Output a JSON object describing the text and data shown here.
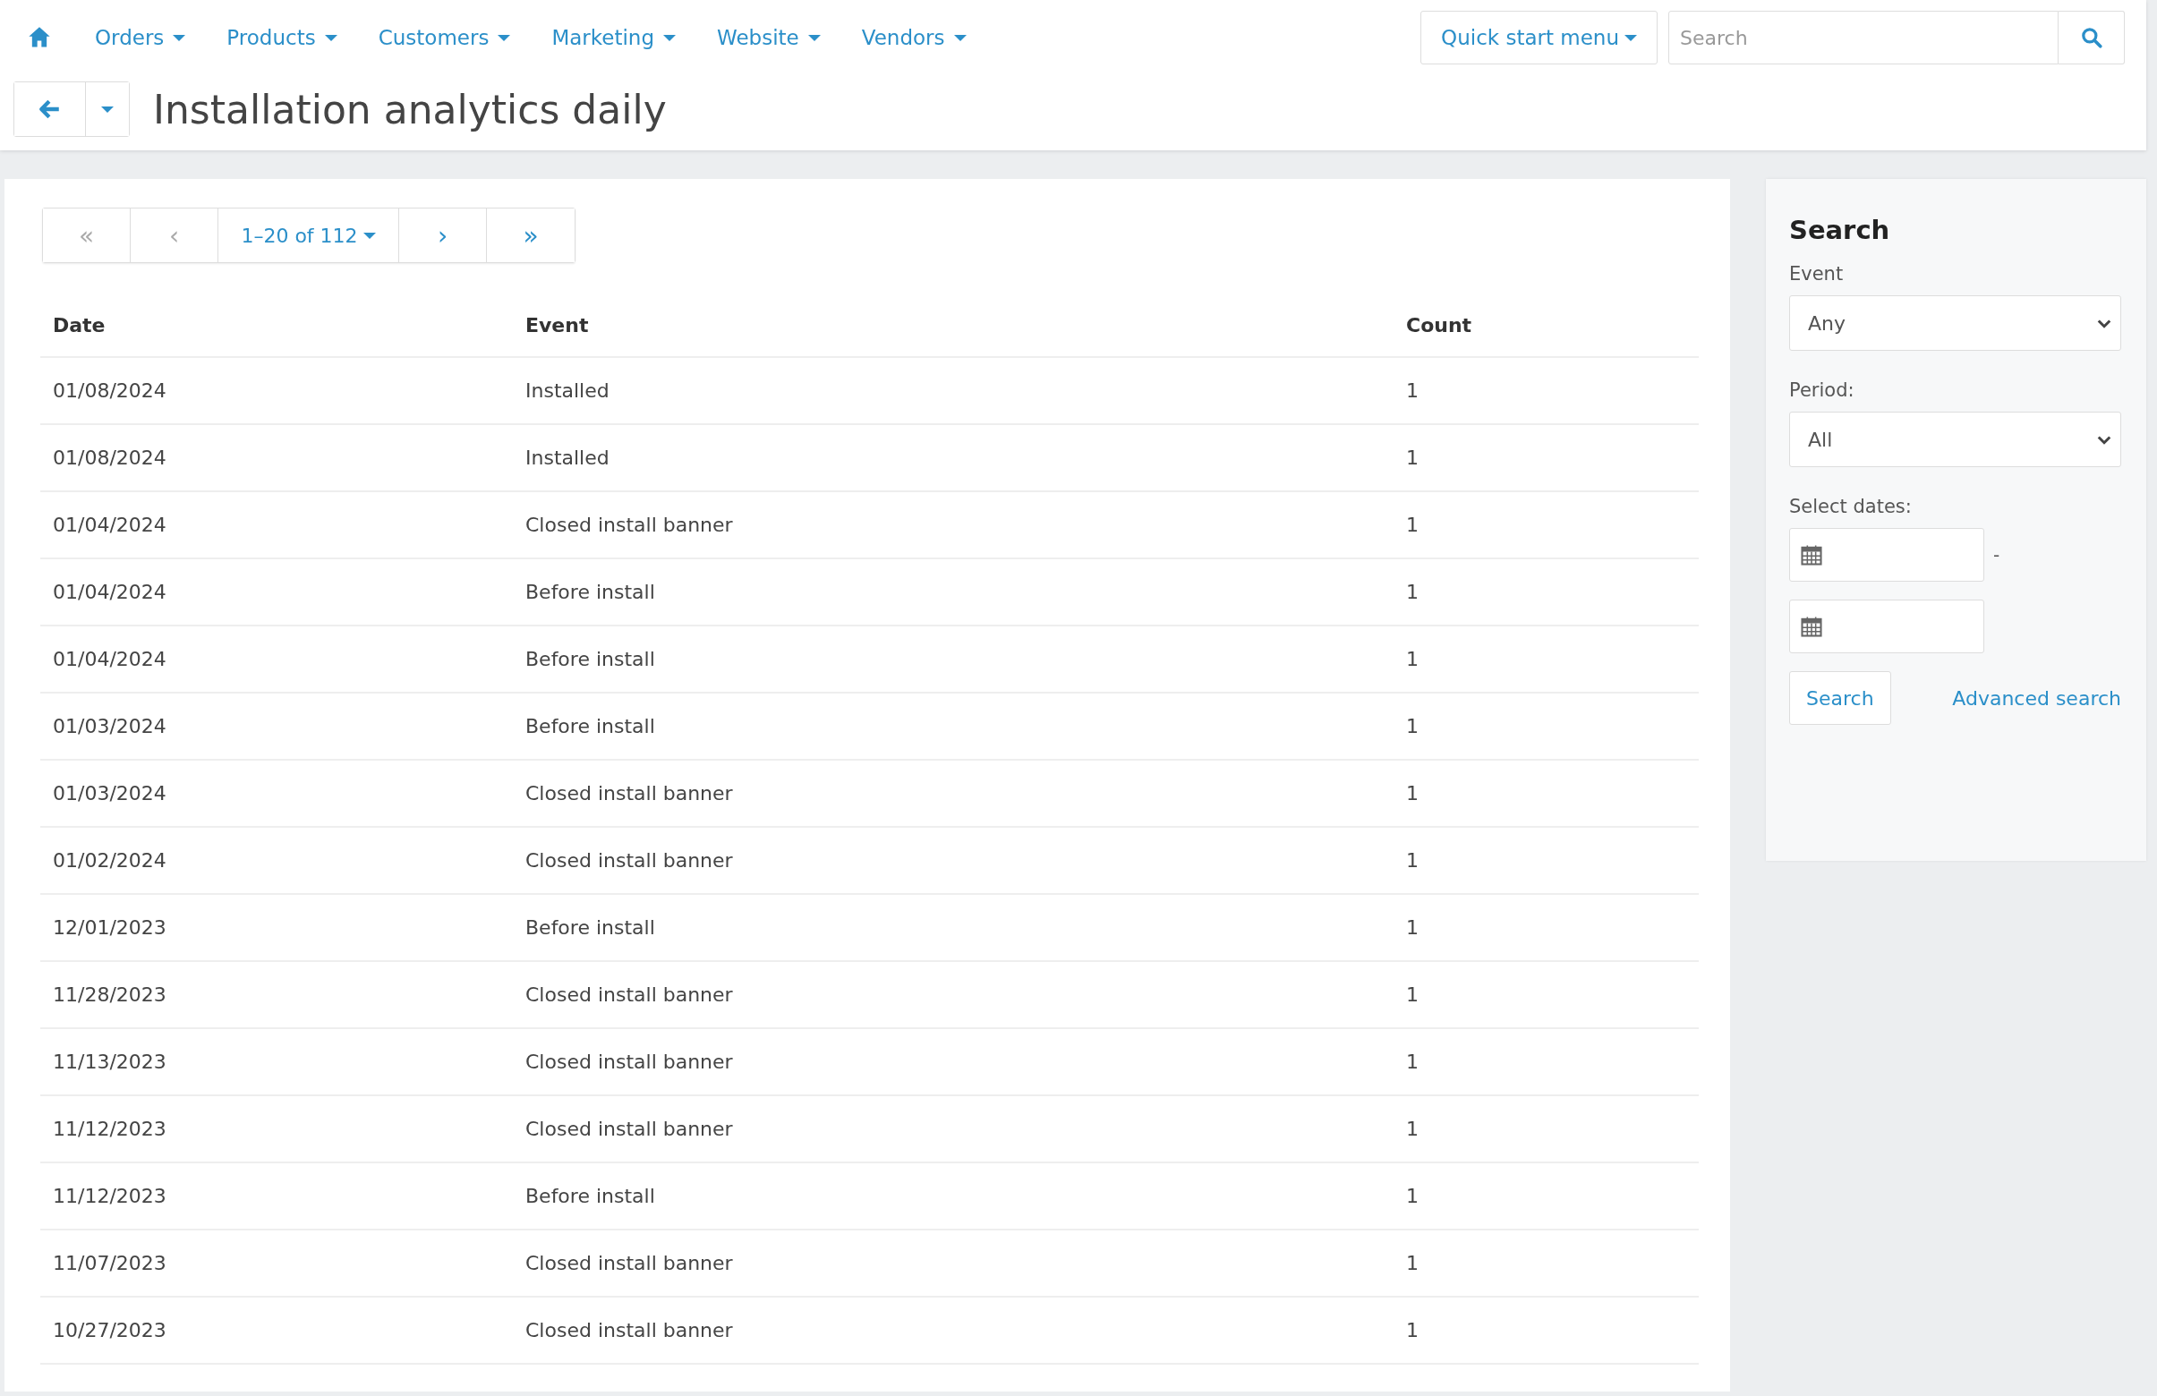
{
  "nav": {
    "items": [
      {
        "label": "Orders"
      },
      {
        "label": "Products"
      },
      {
        "label": "Customers"
      },
      {
        "label": "Marketing"
      },
      {
        "label": "Website"
      },
      {
        "label": "Vendors"
      }
    ],
    "quick_start": "Quick start menu",
    "search": {
      "placeholder": "Search"
    }
  },
  "header": {
    "title": "Installation analytics daily"
  },
  "pagination": [
    {
      "label": "«",
      "kind": "nav",
      "disabled": true
    },
    {
      "label": "‹",
      "kind": "nav",
      "disabled": true
    },
    {
      "label": "1–20 of 112",
      "kind": "range",
      "disabled": false
    },
    {
      "label": "›",
      "kind": "nav",
      "disabled": false
    },
    {
      "label": "»",
      "kind": "nav",
      "disabled": false
    }
  ],
  "table": {
    "columns": [
      "Date",
      "Event",
      "Count"
    ],
    "rows": [
      [
        "01/08/2024",
        "Installed",
        "1"
      ],
      [
        "01/08/2024",
        "Installed",
        "1"
      ],
      [
        "01/04/2024",
        "Closed install banner",
        "1"
      ],
      [
        "01/04/2024",
        "Before install",
        "1"
      ],
      [
        "01/04/2024",
        "Before install",
        "1"
      ],
      [
        "01/03/2024",
        "Before install",
        "1"
      ],
      [
        "01/03/2024",
        "Closed install banner",
        "1"
      ],
      [
        "01/02/2024",
        "Closed install banner",
        "1"
      ],
      [
        "12/01/2023",
        "Before install",
        "1"
      ],
      [
        "11/28/2023",
        "Closed install banner",
        "1"
      ],
      [
        "11/13/2023",
        "Closed install banner",
        "1"
      ],
      [
        "11/12/2023",
        "Closed install banner",
        "1"
      ],
      [
        "11/12/2023",
        "Before install",
        "1"
      ],
      [
        "11/07/2023",
        "Closed install banner",
        "1"
      ],
      [
        "10/27/2023",
        "Closed install banner",
        "1"
      ]
    ]
  },
  "sidebar": {
    "title": "Search",
    "fields": [
      {
        "kind": "select",
        "label": "Event",
        "value": "Any"
      },
      {
        "kind": "select",
        "label": "Period:",
        "value": "All"
      },
      {
        "kind": "dates",
        "label": "Select dates:",
        "separator": "-"
      }
    ],
    "search_button": "Search",
    "advanced_link": "Advanced search"
  }
}
